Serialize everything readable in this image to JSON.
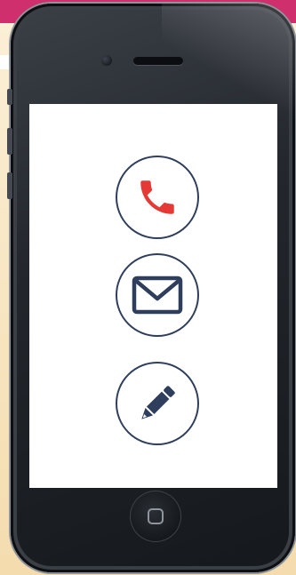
{
  "device": {
    "type": "smartphone",
    "screen_background": "#ffffff"
  },
  "actions": [
    {
      "id": "call",
      "icon": "phone-icon",
      "icon_color": "#e53935"
    },
    {
      "id": "email",
      "icon": "envelope-icon",
      "icon_color": "#2e3e5c"
    },
    {
      "id": "edit",
      "icon": "pencil-icon",
      "icon_color": "#2e3e5c"
    }
  ],
  "colors": {
    "background_band": "#cf2f6c",
    "background": "#f7e6bf",
    "circle_outline": "#2e3e5c",
    "phone_body": "#1c1f23"
  }
}
